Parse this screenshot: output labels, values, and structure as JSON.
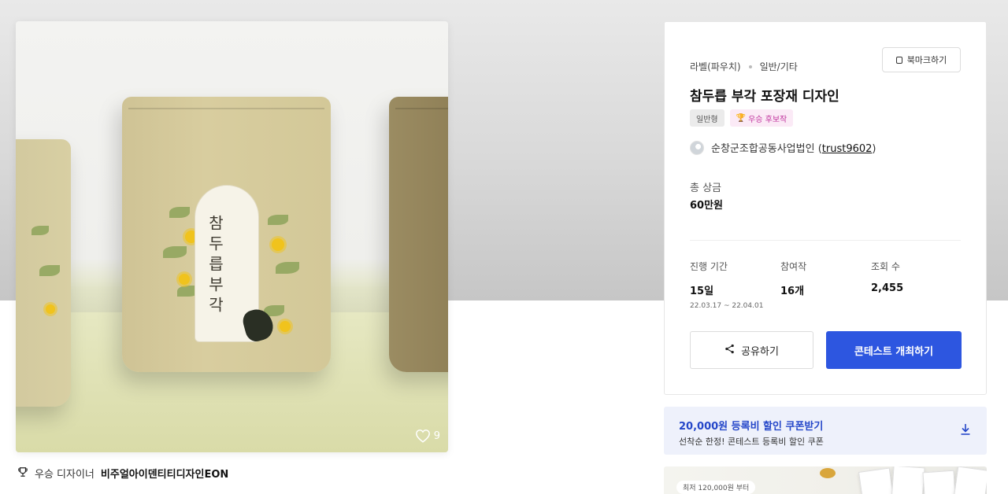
{
  "product": {
    "like_count": "9",
    "pouch_label": "참두릅부각"
  },
  "winner": {
    "prefix": "우승 디자이너",
    "name": "비주얼아이덴티티디자인EON"
  },
  "contest": {
    "category": "라벨(파우치)",
    "subcategory": "일반/기타",
    "bookmark_label": "북마크하기",
    "title": "참두릅 부각 포장재 디자인",
    "tags": {
      "general": "일반형",
      "winner": "우승 후보작"
    },
    "host": {
      "name": "순창군조합공동사업법인 (",
      "id": "trust9602",
      "suffix": ")"
    },
    "prize": {
      "label": "총 상금",
      "value": "60만원"
    },
    "stats": {
      "period": {
        "label": "진행 기간",
        "value": "15일",
        "dates": "22.03.17 ~ 22.04.01"
      },
      "entries": {
        "label": "참여작",
        "value": "16개"
      },
      "views": {
        "label": "조회 수",
        "value": "2,455"
      }
    },
    "share_label": "공유하기",
    "host_contest_label": "콘테스트 개최하기"
  },
  "coupon": {
    "title": "20,000원 등록비 할인 쿠폰받기",
    "subtitle": "선착순 한정! 콘테스트 등록비 할인 쿠폰"
  },
  "promo": {
    "pill": "최저 120,000원 부터"
  },
  "colors": {
    "primary": "#2d56e0",
    "coupon_text": "#2547c9",
    "winner_tag": "#c0339d"
  },
  "icons": [
    "heart-icon",
    "trophy-icon",
    "bookmark-icon",
    "share-icon",
    "download-icon"
  ]
}
